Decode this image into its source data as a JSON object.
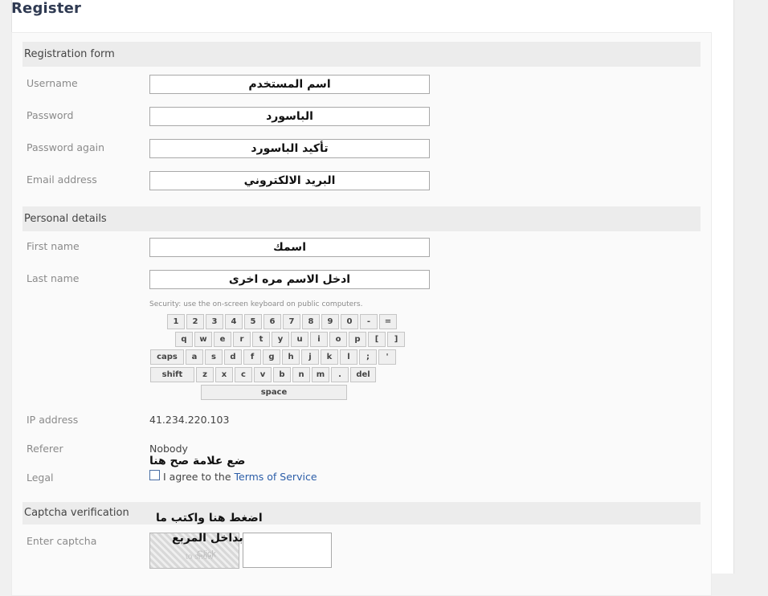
{
  "page": {
    "title": "Register"
  },
  "registration": {
    "heading": "Registration form",
    "fields": [
      {
        "label": "Username",
        "value": "اسم المستخدم"
      },
      {
        "label": "Password",
        "value": "الباسورد"
      },
      {
        "label": "Password again",
        "value": "تأكيد الباسورد"
      },
      {
        "label": "Email address",
        "value": "البريد الالكتروني"
      }
    ]
  },
  "personal": {
    "heading": "Personal details",
    "fields": [
      {
        "label": "First name",
        "value": "اسمك"
      },
      {
        "label": "Last name",
        "value": "ادخل الاسم مره اخرى"
      }
    ]
  },
  "keyboard": {
    "hint": "Security: use the on-screen keyboard on public computers.",
    "row1": [
      "1",
      "2",
      "3",
      "4",
      "5",
      "6",
      "7",
      "8",
      "9",
      "0",
      "-",
      "="
    ],
    "row2": [
      "q",
      "w",
      "e",
      "r",
      "t",
      "y",
      "u",
      "i",
      "o",
      "p",
      "[",
      "]"
    ],
    "row3": [
      "caps",
      "a",
      "s",
      "d",
      "f",
      "g",
      "h",
      "j",
      "k",
      "l",
      ";",
      "'"
    ],
    "row4": [
      "shift",
      "z",
      "x",
      "c",
      "v",
      "b",
      "n",
      "m",
      ".",
      "del"
    ],
    "space": "space"
  },
  "info": {
    "ip_label": "IP address",
    "ip_value": "41.234.220.103",
    "referer_label": "Referer",
    "referer_value": "Nobody",
    "legal_label": "Legal",
    "legal_prefix": "I agree to the",
    "legal_link": "Terms of Service",
    "legal_annotation": "ضع علامة صح هنا"
  },
  "captcha": {
    "heading": "Captcha verification",
    "label": "Enter captcha",
    "annotation_line1": "اضغط هنا واكتب ما",
    "annotation_line2": "بداخل المربع",
    "image_text_1": "Click",
    "image_text_2": "to show"
  }
}
